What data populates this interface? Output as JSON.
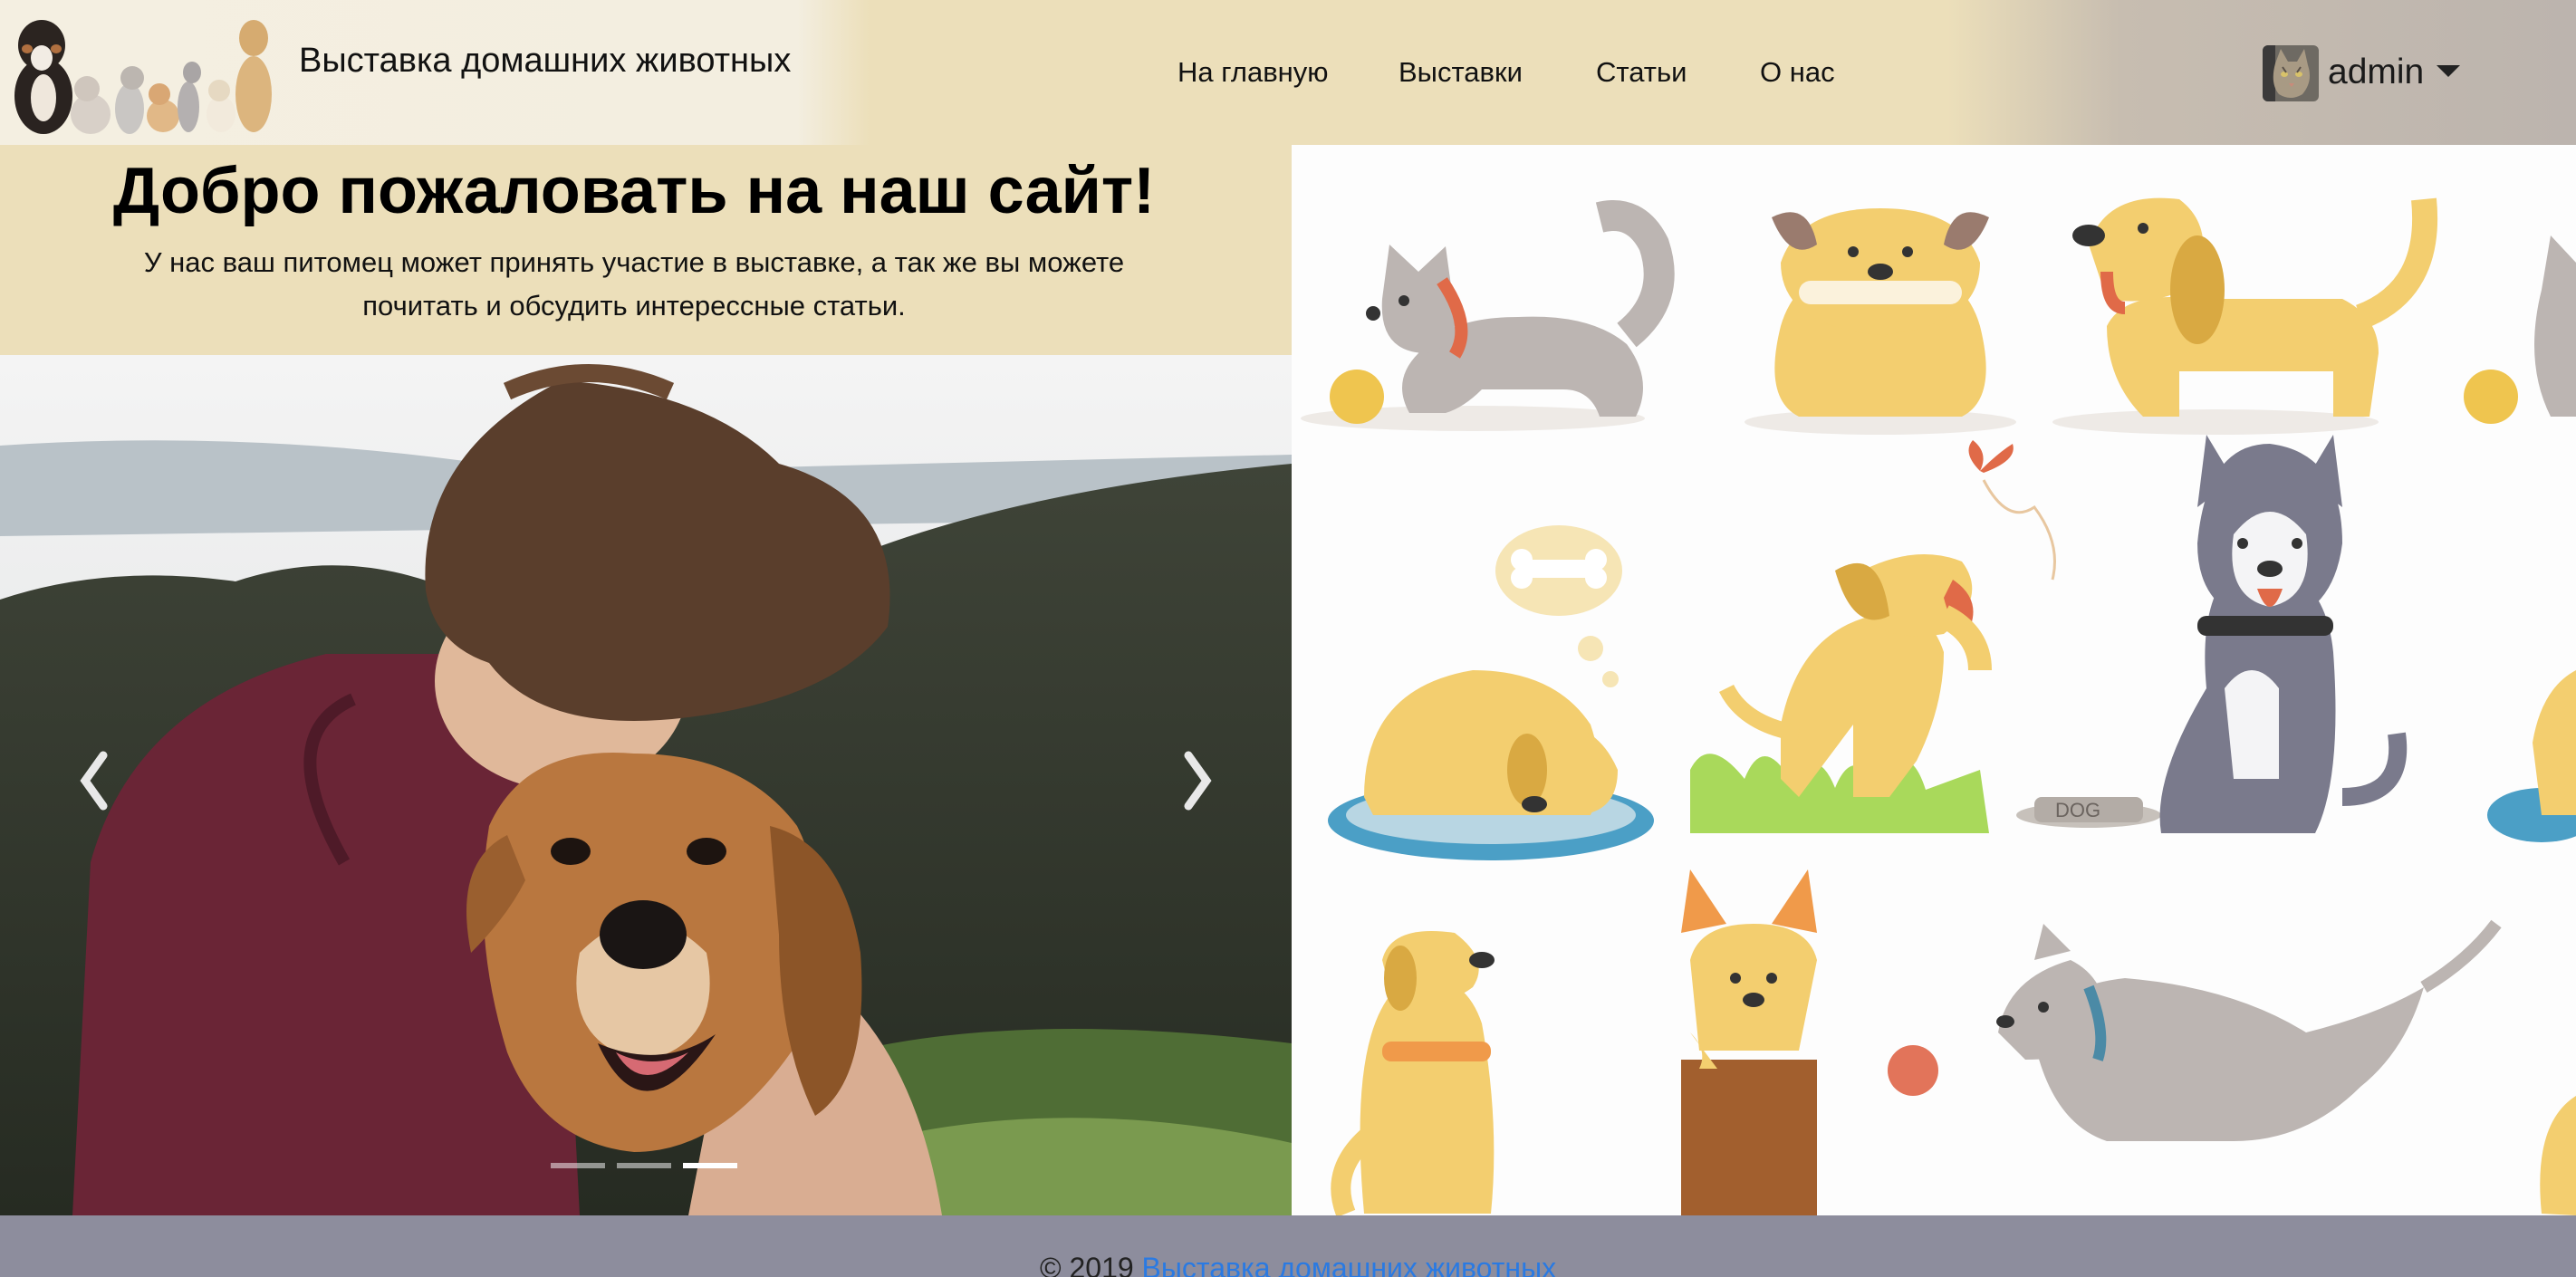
{
  "header": {
    "site_title": "Выставка домашних животных",
    "logo_icon": "pets-group-logo"
  },
  "nav": {
    "items": [
      {
        "label": "На главную"
      },
      {
        "label": "Выставки"
      },
      {
        "label": "Статьи"
      },
      {
        "label": "О нас"
      }
    ]
  },
  "user": {
    "name": "admin",
    "avatar_icon": "cat-avatar-icon",
    "menu_icon": "caret-down-icon"
  },
  "welcome": {
    "title": "Добро пожаловать на наш сайт!",
    "text": "У нас ваш питомец может принять участие в выставке, а так же вы можете почитать и обсудить интерессные статьи."
  },
  "carousel": {
    "slide_count": 3,
    "active_slide": 3,
    "prev_icon": "chevron-left-icon",
    "next_icon": "chevron-right-icon"
  },
  "footer": {
    "copyright": "© 2019",
    "link_text": "Выставка домашних животных"
  },
  "colors": {
    "header_beige": "#ecdfba",
    "footer_gray": "#8d8d9d",
    "link_blue": "#2a7ae2"
  }
}
